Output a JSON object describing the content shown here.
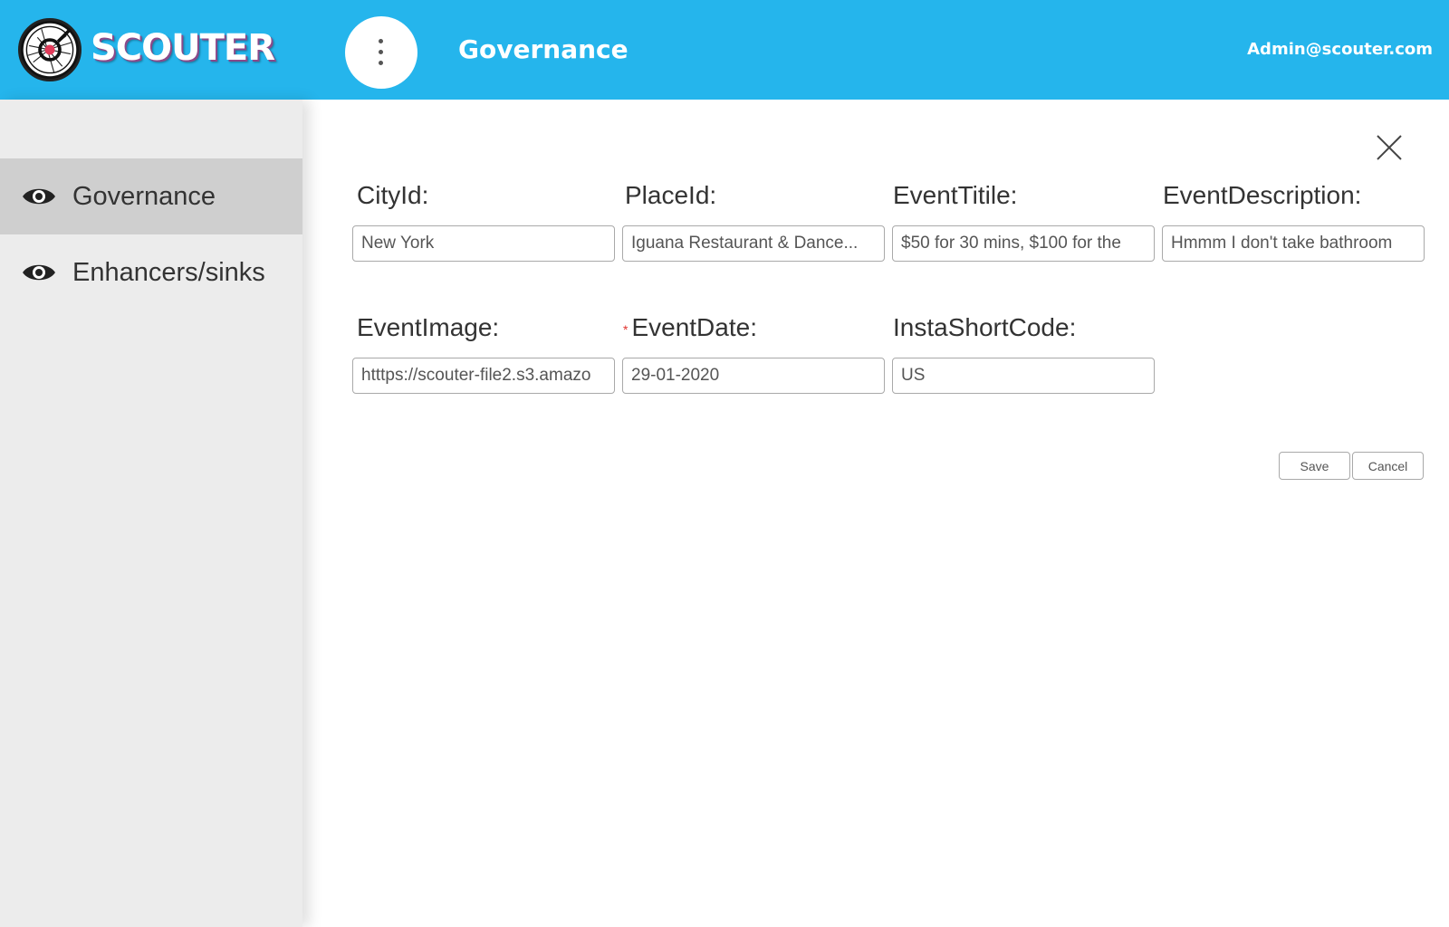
{
  "header": {
    "brand": "SCOUTER",
    "title": "Governance",
    "user": "Admin@scouter.com"
  },
  "sidebar": {
    "items": [
      {
        "label": "Governance",
        "icon": "eye-icon",
        "active": true
      },
      {
        "label": "Enhancers/sinks",
        "icon": "eye-icon",
        "active": false
      }
    ]
  },
  "form": {
    "fields": [
      {
        "label": "CityId:",
        "value": "New York",
        "required": false
      },
      {
        "label": "PlaceId:",
        "value": "Iguana Restaurant & Dance...",
        "required": false
      },
      {
        "label": "EventTitile:",
        "value": "$50 for 30 mins, $100 for the",
        "required": false
      },
      {
        "label": "EventDescription:",
        "value": "Hmmm I don't take bathroom",
        "required": false
      },
      {
        "label": "EventImage:",
        "value": "htttps://scouter-file2.s3.amazo",
        "required": false
      },
      {
        "label": "EventDate:",
        "value": "29-01-2020",
        "required": true,
        "required_mark": "*"
      },
      {
        "label": "InstaShortCode:",
        "value": "US",
        "required": false
      }
    ],
    "save_label": "Save",
    "cancel_label": "Cancel"
  },
  "colors": {
    "header_bg": "#25b5ec",
    "sidebar_bg": "#ececec",
    "sidebar_active": "#cfcfcf",
    "required": "#e0322e"
  }
}
